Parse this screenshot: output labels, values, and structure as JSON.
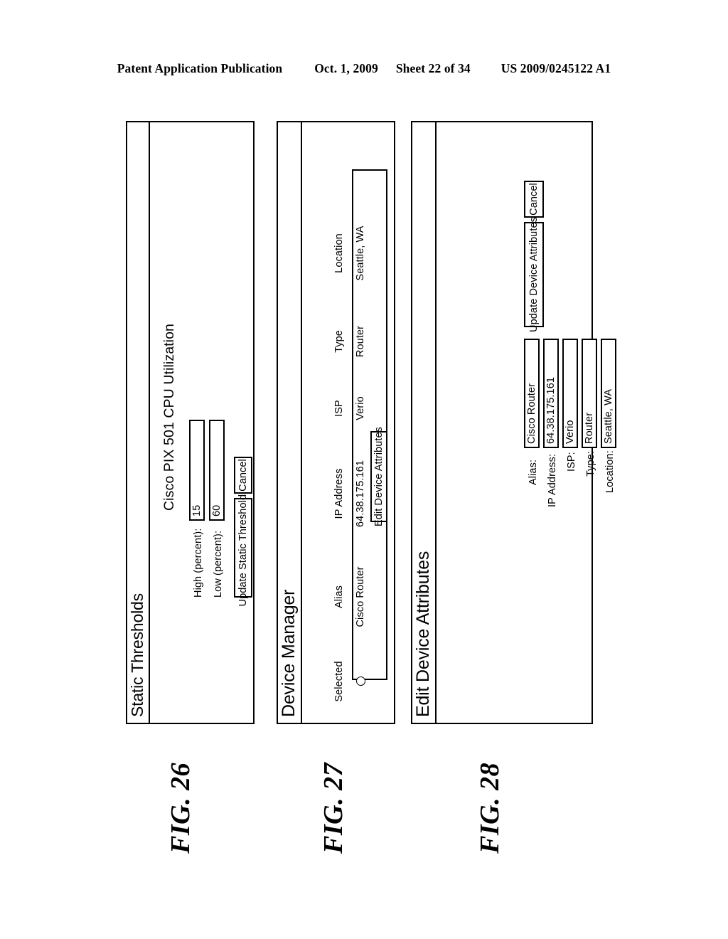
{
  "page_header": {
    "publication": "Patent Application Publication",
    "date": "Oct. 1, 2009",
    "sheet": "Sheet 22 of 34",
    "patent_number": "US 2009/0245122 A1"
  },
  "figures": [
    {
      "label": "FIG. 26",
      "window_title": "Static Thresholds",
      "heading": "Cisco PIX 501   CPU Utilization",
      "fields": [
        {
          "label": "High (percent):",
          "value": "15"
        },
        {
          "label": "Low (percent):",
          "value": "60"
        }
      ],
      "buttons": [
        {
          "label": "Update Static Thresholds"
        },
        {
          "label": "Cancel"
        }
      ]
    },
    {
      "label": "FIG. 27",
      "window_title": "Device Manager",
      "table": {
        "columns": [
          "Selected",
          "Alias",
          "IP Address",
          "ISP",
          "Type",
          "Location"
        ],
        "rows": [
          {
            "selected": "radio-unchecked-icon",
            "alias": "Cisco Router",
            "ip_address": "64.38.175.161",
            "isp": "Verio",
            "type": "Router",
            "location": "Seattle, WA"
          }
        ]
      },
      "buttons": [
        {
          "label": "Edit Device Attributes"
        }
      ]
    },
    {
      "label": "FIG. 28",
      "window_title": "Edit Device Attributes",
      "fields": [
        {
          "label": "Alias:",
          "value": "Cisco Router"
        },
        {
          "label": "IP Address:",
          "value": "64.38.175.161"
        },
        {
          "label": "ISP:",
          "value": "Verio"
        },
        {
          "label": "Type:",
          "value": "Router"
        },
        {
          "label": "Location:",
          "value": "Seattle, WA"
        }
      ],
      "buttons": [
        {
          "label": "Update Device Attributes"
        },
        {
          "label": "Cancel"
        }
      ]
    }
  ],
  "colors": {
    "ink": "#000000",
    "paper": "#ffffff"
  }
}
